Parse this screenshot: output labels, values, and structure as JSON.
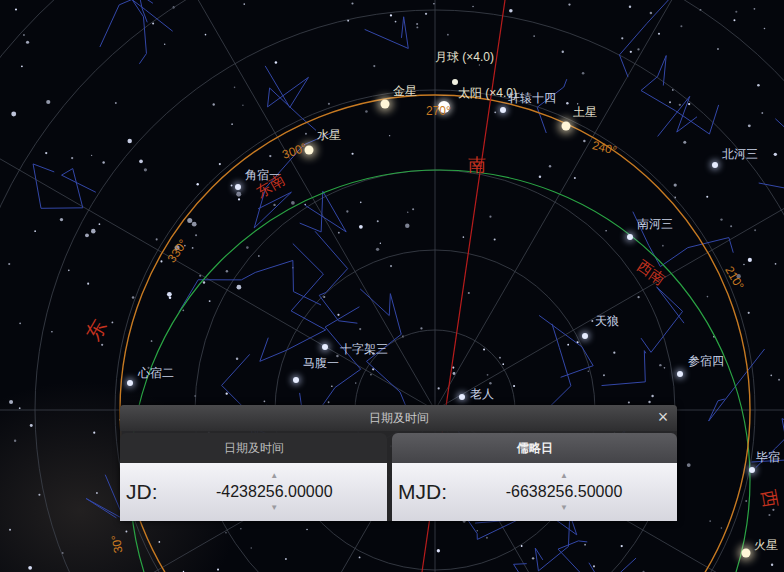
{
  "sky": {
    "objects": [
      {
        "name": "金星",
        "kind": "planet"
      },
      {
        "name": "月球 (×4.0)",
        "kind": "moon"
      },
      {
        "name": "太阳 (×4.0)",
        "kind": "sun"
      },
      {
        "name": "轩辕十四",
        "kind": "star"
      },
      {
        "name": "土星",
        "kind": "planet"
      },
      {
        "name": "水星",
        "kind": "planet"
      },
      {
        "name": "角宿一",
        "kind": "star"
      },
      {
        "name": "北河三",
        "kind": "star"
      },
      {
        "name": "南河三",
        "kind": "star"
      },
      {
        "name": "天狼",
        "kind": "star"
      },
      {
        "name": "参宿四",
        "kind": "star"
      },
      {
        "name": "马腹一",
        "kind": "star"
      },
      {
        "name": "十字架三",
        "kind": "star"
      },
      {
        "name": "心宿二",
        "kind": "star"
      },
      {
        "name": "老人",
        "kind": "star"
      },
      {
        "name": "毕宿",
        "kind": "star"
      },
      {
        "name": "火星",
        "kind": "planet"
      }
    ],
    "cardinals": [
      "东南",
      "南",
      "西南",
      "东",
      "西"
    ],
    "azimuth_labels": [
      "300°",
      "270°",
      "240°",
      "330°",
      "210°",
      "30°"
    ]
  },
  "dialog": {
    "title": "日期及时间",
    "close": "×",
    "panels": [
      {
        "tab": "日期及时间",
        "selected": false,
        "field": {
          "label": "JD:",
          "value": "-4238256.00000"
        }
      },
      {
        "tab": "儒略日",
        "selected": true,
        "field": {
          "label": "MJD:",
          "value": "-6638256.50000"
        }
      }
    ],
    "spin_up": "▲",
    "spin_down": "▼"
  }
}
